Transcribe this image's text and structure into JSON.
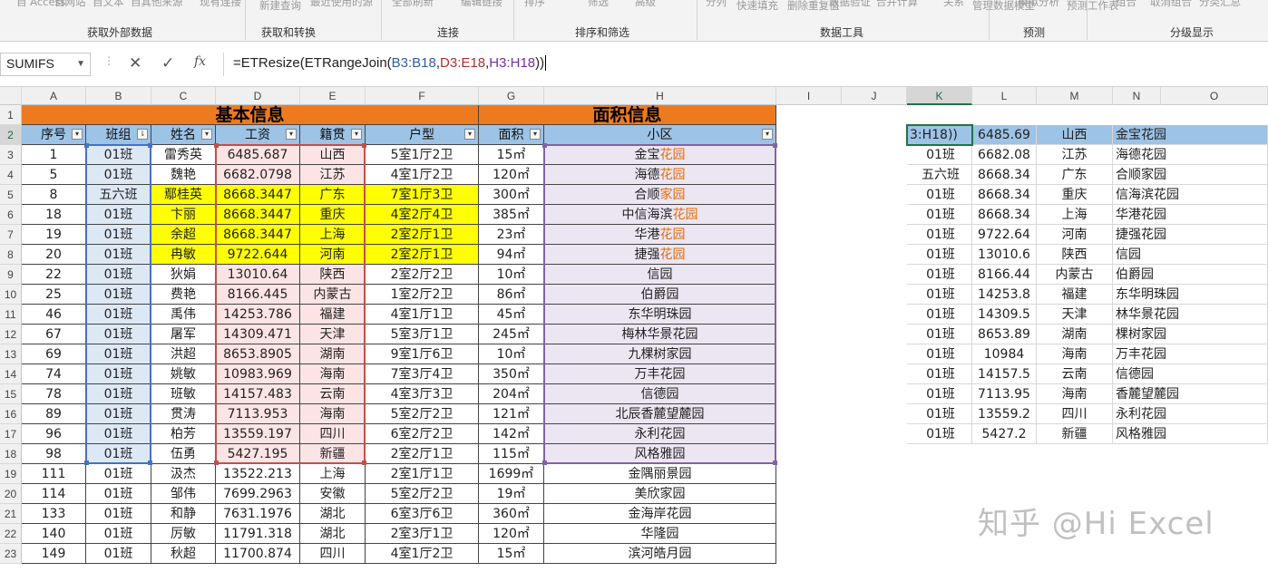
{
  "ribbon": {
    "top_items": [
      "自 Access",
      "自网站",
      "自文本",
      "自其他来源",
      "现有连接",
      "新建查询",
      "最近使用的源",
      "全部刷新",
      "编辑链接",
      "排序",
      "筛选",
      "高级",
      "分列",
      "快速填充",
      "删除重复值",
      "数据验证",
      "合并计算",
      "关系",
      "管理数据模型",
      "模拟分析",
      "预测工作表",
      "组合",
      "取消组合",
      "分类汇总"
    ],
    "groups": [
      "获取外部数据",
      "获取和转换",
      "连接",
      "排序和筛选",
      "数据工具",
      "预测",
      "分级显示"
    ]
  },
  "formula_bar": {
    "name_box": "SUMIFS",
    "cancel_icon": "✕",
    "confirm_icon": "✓",
    "fx_icon": "fx",
    "formula_prefix": "=ETResize(ETRangeJoin(",
    "ref1": "B3:B18",
    "sep1": ",",
    "ref2": "D3:E18",
    "sep2": ",",
    "ref3": "H3:H18",
    "formula_suffix": "))"
  },
  "columns": [
    "A",
    "B",
    "C",
    "D",
    "E",
    "F",
    "G",
    "H",
    "I",
    "J",
    "K",
    "L",
    "M",
    "N",
    "O"
  ],
  "row_numbers": [
    "1",
    "2",
    "3",
    "4",
    "5",
    "6",
    "7",
    "8",
    "9",
    "10",
    "11",
    "12",
    "13",
    "14",
    "15",
    "16",
    "17",
    "18",
    "19",
    "20",
    "21",
    "22",
    "23"
  ],
  "bands": {
    "basic": "基本信息",
    "area": "面积信息"
  },
  "headers": [
    "序号",
    "班组",
    "姓名",
    "工资",
    "籍贯",
    "户型",
    "面积",
    "小区"
  ],
  "rows": [
    {
      "a": "1",
      "b": "01班",
      "c": "雷秀英",
      "d": "6485.687",
      "e": "山西",
      "f": "5室1厅2卫",
      "g": "15㎡",
      "h1": "金宝",
      "h2": "花园",
      "y": false
    },
    {
      "a": "5",
      "b": "01班",
      "c": "魏艳",
      "d": "6682.0798",
      "e": "江苏",
      "f": "4室1厅2卫",
      "g": "120㎡",
      "h1": "海德",
      "h2": "花园",
      "y": false
    },
    {
      "a": "8",
      "b": "五六班",
      "c": "鄢桂英",
      "d": "8668.3447",
      "e": "广东",
      "f": "7室1厅3卫",
      "g": "300㎡",
      "h1": "合顺",
      "h2": "家园",
      "y": true
    },
    {
      "a": "18",
      "b": "01班",
      "c": "卞丽",
      "d": "8668.3447",
      "e": "重庆",
      "f": "4室2厅4卫",
      "g": "385㎡",
      "h1": "中信海滨",
      "h2": "花园",
      "y": true
    },
    {
      "a": "19",
      "b": "01班",
      "c": "余超",
      "d": "8668.3447",
      "e": "上海",
      "f": "2室2厅1卫",
      "g": "23㎡",
      "h1": "华港",
      "h2": "花园",
      "y": true
    },
    {
      "a": "20",
      "b": "01班",
      "c": "冉敏",
      "d": "9722.644",
      "e": "河南",
      "f": "2室2厅1卫",
      "g": "94㎡",
      "h1": "捷强",
      "h2": "花园",
      "y": true
    },
    {
      "a": "22",
      "b": "01班",
      "c": "狄娟",
      "d": "13010.64",
      "e": "陕西",
      "f": "2室2厅2卫",
      "g": "10㎡",
      "h1": "信园",
      "h2": "",
      "y": false
    },
    {
      "a": "25",
      "b": "01班",
      "c": "费艳",
      "d": "8166.445",
      "e": "内蒙古",
      "f": "1室2厅2卫",
      "g": "86㎡",
      "h1": "伯爵园",
      "h2": "",
      "y": false
    },
    {
      "a": "46",
      "b": "01班",
      "c": "禹伟",
      "d": "14253.786",
      "e": "福建",
      "f": "4室1厅1卫",
      "g": "45㎡",
      "h1": "东华明珠园",
      "h2": "",
      "y": false
    },
    {
      "a": "67",
      "b": "01班",
      "c": "屠军",
      "d": "14309.471",
      "e": "天津",
      "f": "5室3厅1卫",
      "g": "245㎡",
      "h1": "梅林华景花园",
      "h2": "",
      "y": false
    },
    {
      "a": "69",
      "b": "01班",
      "c": "洪超",
      "d": "8653.8905",
      "e": "湖南",
      "f": "9室1厅6卫",
      "g": "10㎡",
      "h1": "九棵树家园",
      "h2": "",
      "y": false
    },
    {
      "a": "74",
      "b": "01班",
      "c": "姚敏",
      "d": "10983.969",
      "e": "海南",
      "f": "7室3厅4卫",
      "g": "350㎡",
      "h1": "万丰花园",
      "h2": "",
      "y": false
    },
    {
      "a": "78",
      "b": "01班",
      "c": "班敏",
      "d": "14157.483",
      "e": "云南",
      "f": "4室3厅3卫",
      "g": "204㎡",
      "h1": "信德园",
      "h2": "",
      "y": false
    },
    {
      "a": "89",
      "b": "01班",
      "c": "贯涛",
      "d": "7113.953",
      "e": "海南",
      "f": "5室2厅2卫",
      "g": "121㎡",
      "h1": "北辰香麓望麓园",
      "h2": "",
      "y": false
    },
    {
      "a": "96",
      "b": "01班",
      "c": "柏芳",
      "d": "13559.197",
      "e": "四川",
      "f": "6室2厅2卫",
      "g": "142㎡",
      "h1": "永利花园",
      "h2": "",
      "y": false
    },
    {
      "a": "98",
      "b": "01班",
      "c": "伍勇",
      "d": "5427.195",
      "e": "新疆",
      "f": "2室2厅1卫",
      "g": "115㎡",
      "h1": "风格雅园",
      "h2": "",
      "y": false
    },
    {
      "a": "111",
      "b": "01班",
      "c": "汲杰",
      "d": "13522.213",
      "e": "上海",
      "f": "2室1厅1卫",
      "g": "1699㎡",
      "h1": "金隅丽景园",
      "h2": "",
      "y": false
    },
    {
      "a": "114",
      "b": "01班",
      "c": "邹伟",
      "d": "7699.2963",
      "e": "安徽",
      "f": "5室2厅2卫",
      "g": "19㎡",
      "h1": "美欣家园",
      "h2": "",
      "y": false
    },
    {
      "a": "133",
      "b": "01班",
      "c": "和静",
      "d": "7631.1976",
      "e": "湖北",
      "f": "6室3厅6卫",
      "g": "360㎡",
      "h1": "金海岸花园",
      "h2": "",
      "y": false
    },
    {
      "a": "140",
      "b": "01班",
      "c": "厉敏",
      "d": "11791.318",
      "e": "湖北",
      "f": "2室3厅1卫",
      "g": "120㎡",
      "h1": "华隆园",
      "h2": "",
      "y": false
    },
    {
      "a": "149",
      "b": "01班",
      "c": "秋超",
      "d": "11700.874",
      "e": "四川",
      "f": "4室1厅2卫",
      "g": "15㎡",
      "h1": "滨河皓月园",
      "h2": "",
      "y": false
    }
  ],
  "output": [
    {
      "k": "3:H18))",
      "l": "6485.69",
      "m": "山西",
      "n": "金宝花园"
    },
    {
      "k": "01班",
      "l": "6682.08",
      "m": "江苏",
      "n": "海德花园"
    },
    {
      "k": "五六班",
      "l": "8668.34",
      "m": "广东",
      "n": "合顺家园"
    },
    {
      "k": "01班",
      "l": "8668.34",
      "m": "重庆",
      "n": "信海滨花园"
    },
    {
      "k": "01班",
      "l": "8668.34",
      "m": "上海",
      "n": "华港花园"
    },
    {
      "k": "01班",
      "l": "9722.64",
      "m": "河南",
      "n": "捷强花园"
    },
    {
      "k": "01班",
      "l": "13010.6",
      "m": "陕西",
      "n": "信园"
    },
    {
      "k": "01班",
      "l": "8166.44",
      "m": "内蒙古",
      "n": "伯爵园"
    },
    {
      "k": "01班",
      "l": "14253.8",
      "m": "福建",
      "n": "东华明珠园"
    },
    {
      "k": "01班",
      "l": "14309.5",
      "m": "天津",
      "n": "林华景花园"
    },
    {
      "k": "01班",
      "l": "8653.89",
      "m": "湖南",
      "n": "棵树家园"
    },
    {
      "k": "01班",
      "l": "10984",
      "m": "海南",
      "n": "万丰花园"
    },
    {
      "k": "01班",
      "l": "14157.5",
      "m": "云南",
      "n": "信德园"
    },
    {
      "k": "01班",
      "l": "7113.95",
      "m": "海南",
      "n": "香麓望麓园"
    },
    {
      "k": "01班",
      "l": "13559.2",
      "m": "四川",
      "n": "永利花园"
    },
    {
      "k": "01班",
      "l": "5427.2",
      "m": "新疆",
      "n": "风格雅园"
    }
  ],
  "watermark": "知乎 @Hi Excel",
  "colors": {
    "band": "#ee7a1f",
    "header": "#9dc3e6",
    "highlight": "#ffff00",
    "ref_blue": "#4472c4",
    "ref_red": "#c0504d",
    "ref_purple": "#8064a2",
    "accent_orange": "#e36c09",
    "excel_green": "#217346"
  }
}
